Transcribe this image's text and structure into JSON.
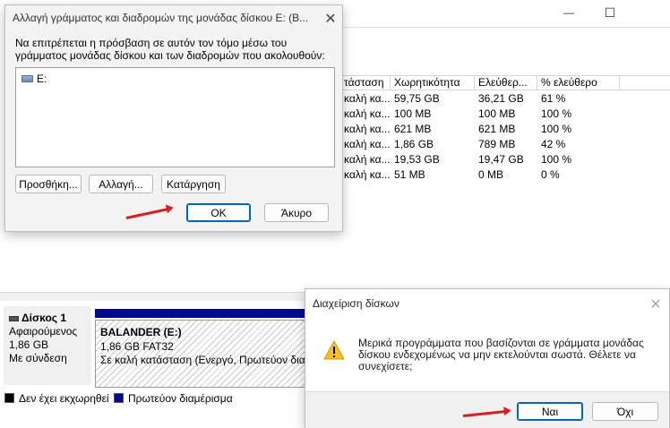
{
  "background_window": {
    "controls": {
      "minimize": "—",
      "maximize": "☐"
    },
    "volume_table": {
      "headers": [
        "τάσταση",
        "Χωρητικότητα",
        "Ελεύθερ...",
        "% ελεύθερο"
      ],
      "rows": [
        [
          "καλή κα...",
          "59,75 GB",
          "36,21 GB",
          "61 %"
        ],
        [
          "καλή κα...",
          "100 MB",
          "100 MB",
          "100 %"
        ],
        [
          "καλή κα...",
          "621 MB",
          "621 MB",
          "100 %"
        ],
        [
          "καλή κα...",
          "1,86 GB",
          "789 MB",
          "42 %"
        ],
        [
          "καλή κα...",
          "19,53 GB",
          "19,47 GB",
          "100 %"
        ],
        [
          "καλή κα...",
          "51 MB",
          "0 MB",
          "0 %"
        ]
      ]
    },
    "disk": {
      "name": "Δίσκος 1",
      "type": "Αφαιρούμενος",
      "size": "1,86 GB",
      "status": "Με σύνδεση"
    },
    "partition": {
      "label": "BALANDER  (E:)",
      "size_fs": "1,86 GB FAT32",
      "status": "Σε καλή κατάσταση (Ενεργό, Πρωτεύον διαμ"
    },
    "legend": [
      {
        "label": "Δεν έχει εκχωρηθεί",
        "color": "#000000"
      },
      {
        "label": "Πρωτεύον διαμέρισμα",
        "color": "#000a8a"
      }
    ]
  },
  "change_letter_dialog": {
    "title": "Αλλαγή γράμματος και διαδρομών της μονάδας δίσκου E: (B...",
    "close": "✕",
    "description": "Να επιτρέπεται η πρόσβαση σε αυτόν τον τόμο μέσω του γράμματος μονάδας δίσκου και των διαδρομών που ακολουθούν:",
    "drive_item": "E:",
    "buttons": {
      "add": "Προσθήκη...",
      "change": "Αλλαγή...",
      "remove": "Κατάργηση",
      "ok": "OK",
      "cancel": "Άκυρο"
    }
  },
  "confirm_dialog": {
    "title": "Διαχείριση δίσκων",
    "close": "✕",
    "icon": "warning-icon",
    "message": "Μερικά προγράμματα που βασίζονται σε γράμματα μονάδας δίσκου ενδεχομένως να μην εκτελούνται σωστά. Θέλετε να συνεχίσετε;",
    "buttons": {
      "yes": "Ναι",
      "no": "Όχι"
    }
  },
  "colors": {
    "accent": "#0067c0",
    "annotation_arrow": "#d81e1e",
    "primary_partition": "#000a8a"
  }
}
